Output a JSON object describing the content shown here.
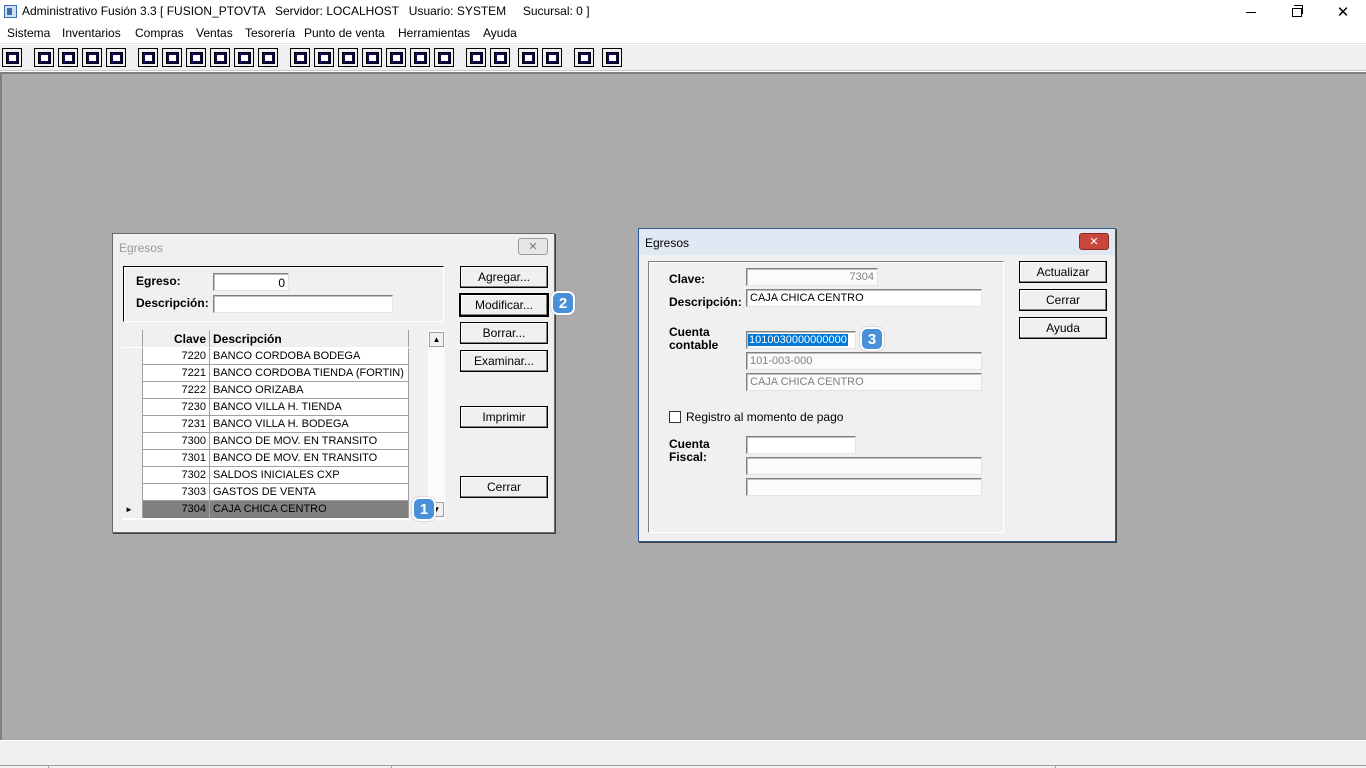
{
  "window": {
    "title": "Administrativo Fusión 3.3 [ FUSION_PTOVTA   Servidor: LOCALHOST   Usuario: SYSTEM     Sucursal: 0 ]"
  },
  "menu": [
    "Sistema",
    "Inventarios",
    "Compras",
    "Ventas",
    "Tesorería",
    "Punto de venta",
    "Herramientas",
    "Ayuda"
  ],
  "toolbar": {
    "icons": [
      "calculator-icon",
      "copy-icon",
      "clipboard-icon",
      "transfer-icon",
      "search-icon",
      "user-icon",
      "folder-icon",
      "print-preview-icon",
      "print-icon",
      "document-icon",
      "list-icon",
      "split-icon",
      "box-icon",
      "import-icon",
      "add-icon",
      "money-icon",
      "report-icon",
      "table-icon",
      "home-icon",
      "zoom-icon",
      "refresh-icon",
      "undo-icon",
      "back-icon",
      "help-icon"
    ]
  },
  "egresos_list": {
    "title": "Egresos",
    "egreso_label": "Egreso:",
    "egreso_value": "0",
    "descripcion_label": "Descripción:",
    "descripcion_value": "",
    "col_clave": "Clave",
    "col_descripcion": "Descripción",
    "rows": [
      {
        "clave": "7220",
        "descripcion": "BANCO CORDOBA BODEGA"
      },
      {
        "clave": "7221",
        "descripcion": "BANCO CORDOBA TIENDA (FORTIN)"
      },
      {
        "clave": "7222",
        "descripcion": "BANCO ORIZABA"
      },
      {
        "clave": "7230",
        "descripcion": "BANCO VILLA H. TIENDA"
      },
      {
        "clave": "7231",
        "descripcion": "BANCO VILLA H. BODEGA"
      },
      {
        "clave": "7300",
        "descripcion": "BANCO DE MOV. EN TRANSITO"
      },
      {
        "clave": "7301",
        "descripcion": "BANCO DE MOV. EN TRANSITO"
      },
      {
        "clave": "7302",
        "descripcion": "SALDOS INICIALES CXP"
      },
      {
        "clave": "7303",
        "descripcion": "GASTOS DE VENTA"
      },
      {
        "clave": "7304",
        "descripcion": "CAJA CHICA CENTRO"
      }
    ],
    "selected_indicator": "►",
    "buttons": {
      "agregar": "Agregar...",
      "modificar": "Modificar...",
      "borrar": "Borrar...",
      "examinar": "Examinar...",
      "imprimir": "Imprimir",
      "cerrar": "Cerrar"
    }
  },
  "egresos_detail": {
    "title": "Egresos",
    "clave_label": "Clave:",
    "clave_value": "7304",
    "descripcion_label": "Descripción:",
    "descripcion_value": "CAJA CHICA CENTRO",
    "cuenta_contable_label_1": "Cuenta",
    "cuenta_contable_label_2": "contable",
    "cuenta_contable_value": "1010030000000000",
    "cuenta_formatted": "101-003-000",
    "cuenta_nombre": "CAJA CHICA CENTRO",
    "registro_label": "Registro al momento de pago",
    "cuenta_fiscal_label_1": "Cuenta",
    "cuenta_fiscal_label_2": "Fiscal:",
    "buttons": {
      "actualizar": "Actualizar",
      "cerrar": "Cerrar",
      "ayuda": "Ayuda"
    }
  },
  "badges": [
    "1",
    "2",
    "3"
  ]
}
